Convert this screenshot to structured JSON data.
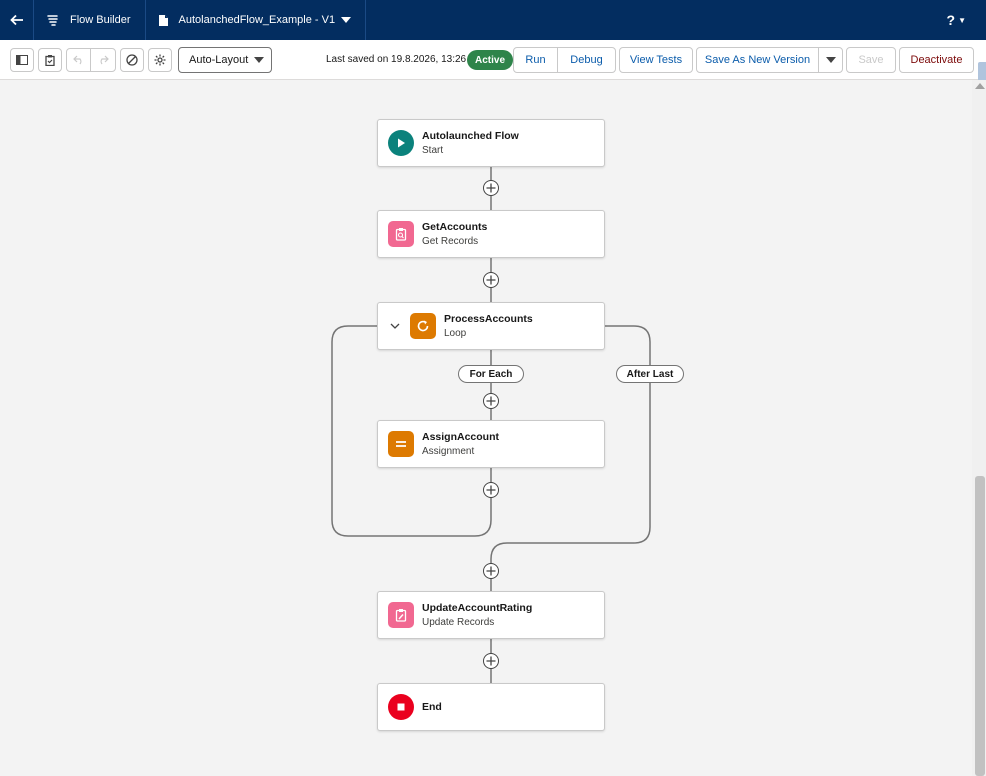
{
  "topbar": {
    "app_name": "Flow Builder",
    "flow_name": "AutolanchedFlow_Example - V1",
    "help_label": "?",
    "icons": [
      "back-arrow-icon",
      "flow-icon",
      "document-icon",
      "chevron-down-icon"
    ]
  },
  "toolbar": {
    "layout_select": "Auto-Layout",
    "last_saved": "Last saved on 19.8.2026, 13:26",
    "status_badge": "Active",
    "run_label": "Run",
    "debug_label": "Debug",
    "view_tests_label": "View Tests",
    "save_as_new_version_label": "Save As New Version",
    "save_label": "Save",
    "deactivate_label": "Deactivate",
    "icons": [
      "panel-toggle-icon",
      "checklist-icon",
      "undo-icon",
      "redo-icon",
      "disable-icon",
      "settings-icon"
    ]
  },
  "flow": {
    "nodes": [
      {
        "title": "Autolaunched Flow",
        "subtitle": "Start",
        "icon": "play-icon",
        "color": "#0b827c"
      },
      {
        "title": "GetAccounts",
        "subtitle": "Get Records",
        "icon": "get-records-icon",
        "color": "#f16891"
      },
      {
        "title": "ProcessAccounts",
        "subtitle": "Loop",
        "icon": "loop-icon",
        "color": "#dd7a01"
      },
      {
        "title": "AssignAccount",
        "subtitle": "Assignment",
        "icon": "assignment-icon",
        "color": "#dd7a01"
      },
      {
        "title": "UpdateAccountRating",
        "subtitle": "Update Records",
        "icon": "update-records-icon",
        "color": "#f16891"
      },
      {
        "title": "End",
        "subtitle": "",
        "icon": "stop-icon",
        "color": "#ea001e"
      }
    ],
    "for_each_label": "For Each",
    "after_last_label": "After Last"
  },
  "colors": {
    "header_bg": "#032d60",
    "active_badge": "#2e844a",
    "link_blue": "#0b5cab",
    "deactivate_red": "#7c0a0a"
  }
}
